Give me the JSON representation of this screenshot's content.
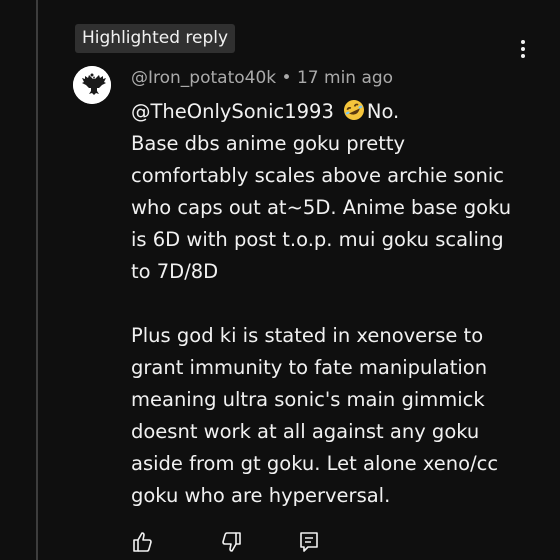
{
  "badge": {
    "label": "Highlighted reply"
  },
  "comment": {
    "author": "@Iron_potato40k",
    "separator": " • ",
    "time": "17 min ago",
    "mention": "@TheOnlySonic1993",
    "emoji_name": "rolling-on-floor-laughing-emoji",
    "first_line_rest": "No.",
    "paragraph1_lines": [
      "Base dbs anime goku pretty",
      "comfortably scales above archie sonic",
      "who caps out at~5D. Anime base goku",
      "is 6D with post t.o.p. mui goku scaling",
      "to 7D/8D"
    ],
    "paragraph2_lines": [
      "Plus god ki is stated in xenoverse to",
      "grant immunity to fate manipulation",
      "meaning ultra sonic's main gimmick",
      "doesnt work at all against any goku",
      "aside from gt goku. Let alone xeno/cc",
      "goku who are hyperversal."
    ]
  },
  "actions": {
    "icons": [
      "thumbs-up-icon",
      "thumbs-down-icon",
      "reply-icon"
    ]
  },
  "colors": {
    "background": "#0f0f0f",
    "text": "#f1f1f1",
    "meta": "#aaaaaa",
    "badge_bg": "#303030",
    "thread_line": "#3d3d3d"
  }
}
